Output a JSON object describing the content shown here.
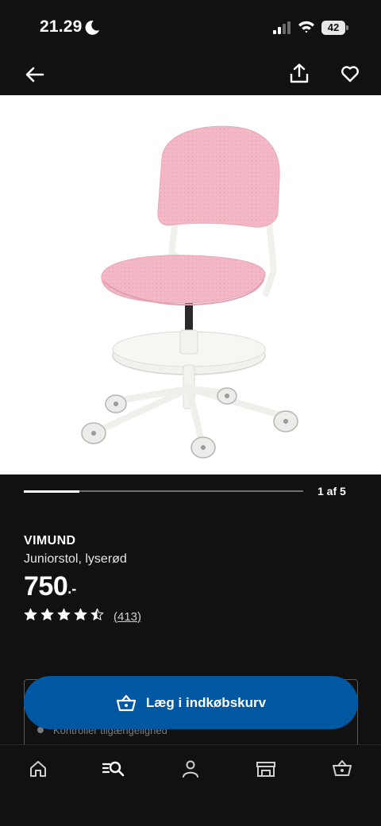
{
  "status_bar": {
    "time": "21.29",
    "battery": "42",
    "icons": [
      "moon-icon",
      "signal-icon",
      "wifi-icon",
      "battery-icon"
    ]
  },
  "top_nav": {
    "icons": [
      "back-arrow-icon",
      "share-icon",
      "heart-icon"
    ]
  },
  "gallery": {
    "count_label": "1 af 5",
    "current": 1,
    "total": 5,
    "progress": 0.2
  },
  "product": {
    "name": "VIMUND",
    "description": "Juniorstol, lyserød",
    "price": "750",
    "price_suffix": ".-",
    "rating": 4.5,
    "max_rating": 5,
    "review_count": "(413)"
  },
  "info_box": {
    "partial_text": "Kontroller tilgængelighed"
  },
  "cart_button": {
    "label": "Læg i indkøbskurv",
    "icon": "basket-icon"
  },
  "bottom_nav": {
    "items": [
      "home-icon",
      "search-icon",
      "profile-icon",
      "store-icon",
      "basket-icon"
    ]
  },
  "colors": {
    "background": "#111111",
    "primary_button": "#0058a3",
    "chair_pink": "#f2b8c6",
    "frame_white": "#f3f3f0"
  }
}
